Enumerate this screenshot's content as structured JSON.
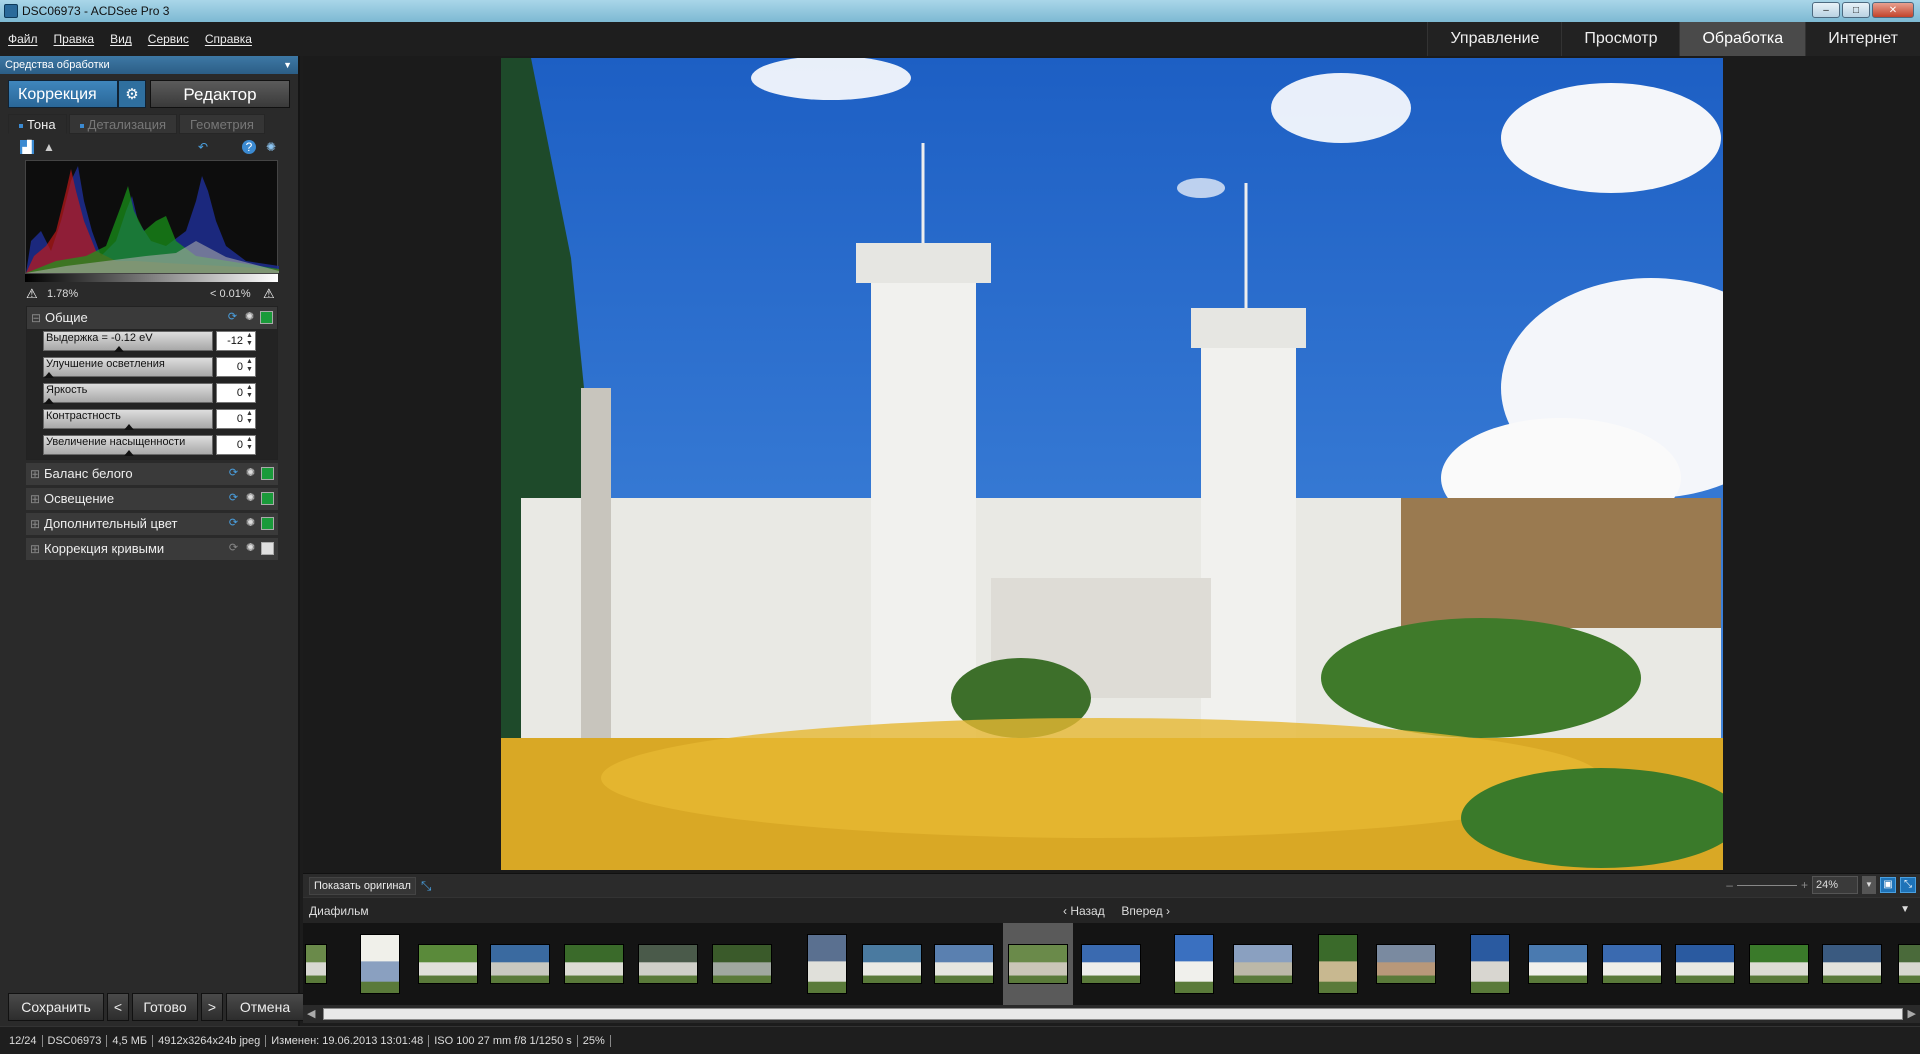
{
  "window": {
    "title": "DSC06973 - ACDSee Pro 3",
    "buttons": {
      "minimize": "–",
      "maximize": "□",
      "close": "✕"
    }
  },
  "menu": [
    "Файл",
    "Правка",
    "Вид",
    "Сервис",
    "Справка"
  ],
  "modes": [
    {
      "label": "Управление",
      "active": false
    },
    {
      "label": "Просмотр",
      "active": false
    },
    {
      "label": "Обработка",
      "active": true
    },
    {
      "label": "Интернет",
      "active": false
    }
  ],
  "panel": {
    "title": "Средства обработки",
    "correction_label": "Коррекция",
    "editor_label": "Редактор",
    "tabs": [
      {
        "label": "Тона",
        "active": true
      },
      {
        "label": "Детализация",
        "active": false
      },
      {
        "label": "Геометрия",
        "active": false
      }
    ],
    "clip_shadows": "1.78%",
    "clip_highlights": "< 0.01%",
    "general": {
      "title": "Общие",
      "sliders": [
        {
          "label": "Выдержка = -0.12 eV",
          "value": "-12",
          "level": 0.44
        },
        {
          "label": "Улучшение осветления",
          "value": "0",
          "level": 0.0
        },
        {
          "label": "Яркость",
          "value": "0",
          "level": 0.0
        },
        {
          "label": "Контрастность",
          "value": "0",
          "level": 0.5
        },
        {
          "label": "Увеличение насыщенности",
          "value": "0",
          "level": 0.5
        }
      ]
    },
    "groups": [
      {
        "label": "Баланс белого",
        "enabled": true
      },
      {
        "label": "Освещение",
        "enabled": true
      },
      {
        "label": "Дополнительный цвет",
        "enabled": true
      },
      {
        "label": "Коррекция кривыми",
        "enabled": false
      }
    ],
    "buttons": {
      "save": "Сохранить",
      "prev": "<",
      "done": "Готово",
      "next": ">",
      "cancel": "Отмена"
    }
  },
  "viewer": {
    "show_original": "Показать оригинал",
    "zoom": "24%"
  },
  "filmstrip": {
    "title": "Диафильм",
    "back": "Назад",
    "forward": "Вперед",
    "selected_index": 10
  },
  "status": [
    "12/24",
    "DSC06973",
    "4,5 МБ",
    "4912x3264x24b jpeg",
    "Изменен: 19.06.2013 13:01:48",
    "ISO 100   27 mm   f/8   1/1250 s",
    "25%"
  ]
}
